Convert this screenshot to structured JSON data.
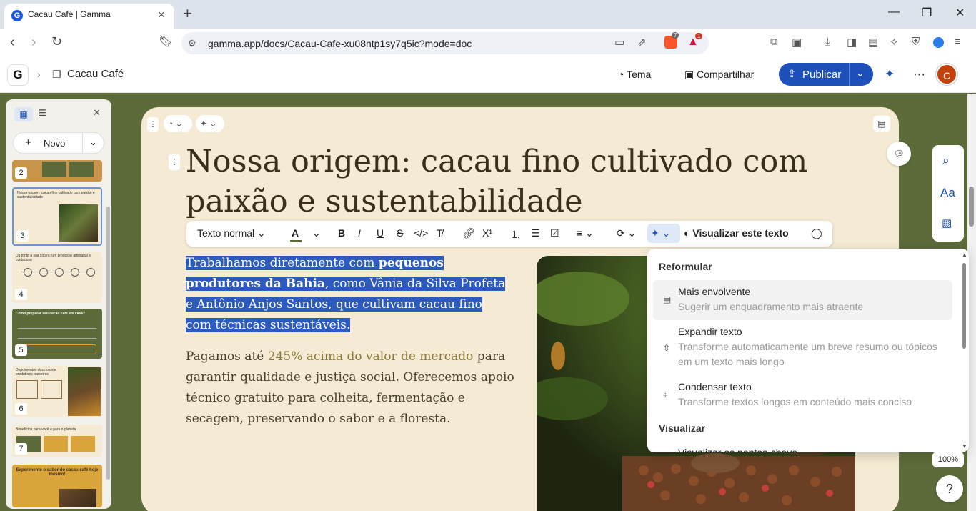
{
  "browser": {
    "tab_title": "Cacau Café | Gamma",
    "favicon_letter": "G",
    "url": "gamma.app/docs/Cacau-Cafe-xu08ntp1sy7q5ic?mode=doc",
    "brave_badge": "7",
    "alert_badge": "1"
  },
  "header": {
    "doc_title": "Cacau Café",
    "theme_label": "Tema",
    "share_label": "Compartilhar",
    "publish_label": "Publicar",
    "avatar_initial": "C"
  },
  "sidebar": {
    "new_label": "Novo",
    "pages": [
      "2",
      "3",
      "4",
      "5",
      "6",
      "7"
    ],
    "thumb3_title": "Nossa origem: cacau fino cultivado com paixão e sustentabilidade",
    "thumb4_title": "Da fonte a sua xícara: um processo artesanal e cuidadoso",
    "thumb5_title": "Como preparar seu cacau café em casa?",
    "thumb6_title": "Depoimentos dos nossos produtores parceiros",
    "thumb7_title": "Benefícios para você e para o planeta",
    "thumb8_title": "Experimente o sabor do cacau café hoje mesmo!"
  },
  "doc": {
    "heading": "Nossa origem: cacau fino cultivado com paixão e sustentabilidade",
    "p1_a": "Trabalhamos diretamente com ",
    "p1_bold": "pequenos produtores da Bahia",
    "p1_b": ", como Vânia da Silva Profeta e Antônio Anjos Santos, que cultivam cacau fino com técnicas sustentáveis.",
    "p2_a": "Pagamos até ",
    "p2_highlight": "245% acima do valor de mercado",
    "p2_b": " para garantir qualidade e justiça social. Oferecemos apoio técnico gratuito para colheita, fermentação e secagem, preservando o sabor e a floresta."
  },
  "format_toolbar": {
    "style_label": "Texto normal",
    "visualize_label": "Visualizar este texto"
  },
  "ai_menu": {
    "section1": "Reformular",
    "items": [
      {
        "title": "Mais envolvente",
        "desc": "Sugerir um enquadramento mais atraente"
      },
      {
        "title": "Expandir texto",
        "desc": "Transforme automaticamente um breve resumo ou tópicos em um texto mais longo"
      },
      {
        "title": "Condensar texto",
        "desc": "Transforme textos longos em conteúdo mais conciso"
      }
    ],
    "section2": "Visualizar",
    "partial_item": "Visualizar os pontos-chave"
  },
  "zoom_label": "100%",
  "help_label": "?",
  "colors": {
    "accent": "#1d4fb8",
    "canvas": "#5d6b3a",
    "card": "#f5ead3",
    "selection": "#2d5bbd"
  }
}
